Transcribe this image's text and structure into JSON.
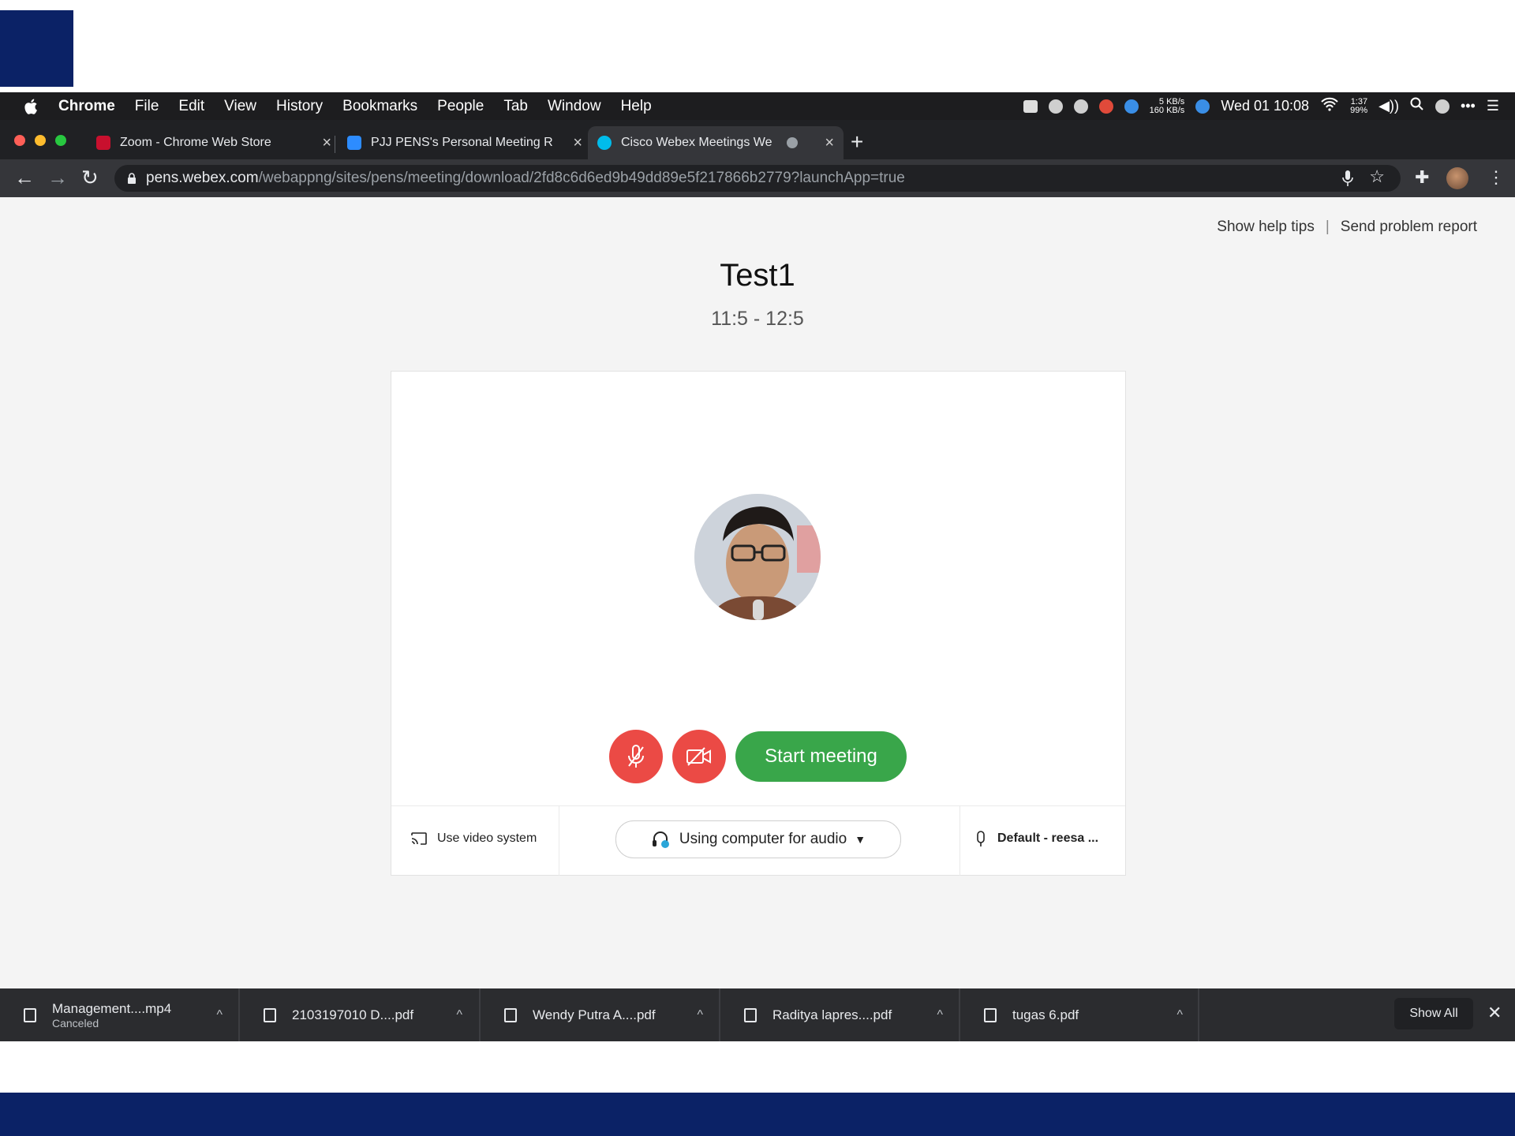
{
  "menubar": {
    "app": "Chrome",
    "items": [
      "File",
      "Edit",
      "View",
      "History",
      "Bookmarks",
      "People",
      "Tab",
      "Window",
      "Help"
    ],
    "clock": "Wed 01 10:08",
    "net_up": "5 KB/s",
    "net_down": "160 KB/s",
    "battery_time": "1:37",
    "battery_pct": "99%"
  },
  "tabs": [
    {
      "title": "Zoom - Chrome Web Store",
      "favicon_color": "#c8102e"
    },
    {
      "title": "PJJ PENS's Personal Meeting R",
      "favicon_color": "#2d8cff"
    },
    {
      "title": "Cisco Webex Meetings We",
      "favicon_color": "#00bceb"
    }
  ],
  "address": {
    "host": "pens.webex.com",
    "path": "/webappng/sites/pens/meeting/download/2fd8c6d6ed9b49dd89e5f217866b2779?launchApp=true"
  },
  "page": {
    "help_tips": "Show help tips",
    "separator": "|",
    "problem_report": "Send problem report",
    "meeting_title": "Test1",
    "meeting_time": "11:5 - 12:5",
    "start_button": "Start meeting",
    "video_system": "Use video system",
    "audio_option": "Using computer for audio",
    "mic_device": "Default - reesa ..."
  },
  "downloads": [
    {
      "name": "Management....mp4",
      "status": "Canceled"
    },
    {
      "name": "2103197010 D....pdf",
      "status": ""
    },
    {
      "name": "Wendy Putra A....pdf",
      "status": ""
    },
    {
      "name": "Raditya lapres....pdf",
      "status": ""
    },
    {
      "name": "tugas 6.pdf",
      "status": ""
    }
  ],
  "shelf": {
    "show_all": "Show All"
  },
  "colors": {
    "slide_accent": "#0b2266",
    "start_green": "#39a64a",
    "control_red": "#eb4a45"
  }
}
